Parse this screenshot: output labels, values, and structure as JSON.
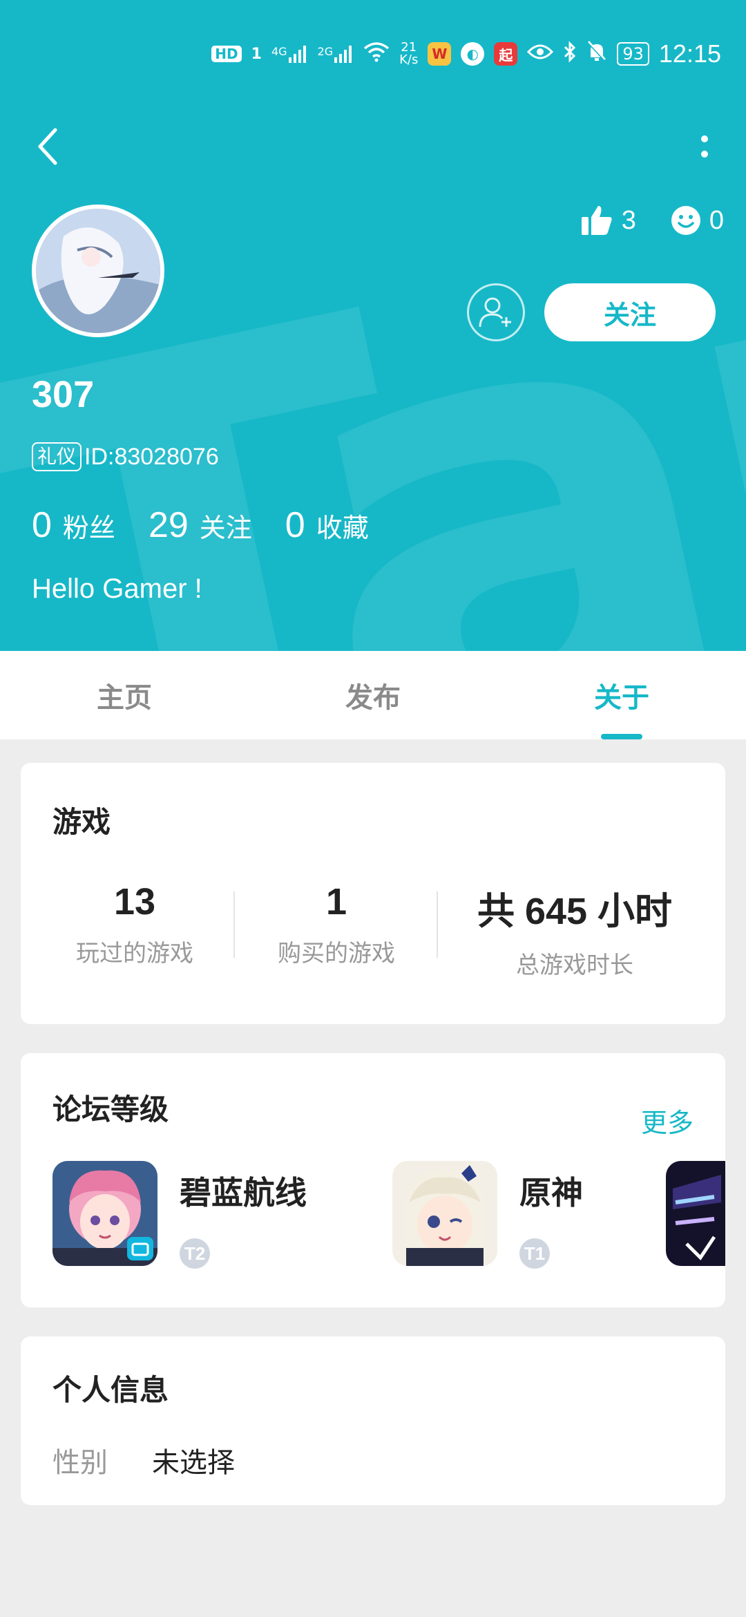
{
  "statusbar": {
    "hd": "HD",
    "sim": "1",
    "net1": "4G",
    "net2": "2G",
    "speed_value": "21",
    "speed_unit": "K/s",
    "battery": "93",
    "time": "12:15"
  },
  "header": {
    "bg_color": "#16b8c8",
    "watermark": "ApTap"
  },
  "profile": {
    "likes": "3",
    "smiles": "0",
    "follow_label": "关注",
    "username": "307",
    "badge": "礼仪",
    "id_text": "ID:83028076",
    "stats": [
      {
        "num": "0",
        "label": "粉丝"
      },
      {
        "num": "29",
        "label": "关注"
      },
      {
        "num": "0",
        "label": "收藏"
      }
    ],
    "bio": "Hello Gamer !"
  },
  "tabs": [
    {
      "label": "主页"
    },
    {
      "label": "发布"
    },
    {
      "label": "关于"
    }
  ],
  "games_card": {
    "title": "游戏",
    "stats": [
      {
        "num": "13",
        "label": "玩过的游戏"
      },
      {
        "num": "1",
        "label": "购买的游戏"
      },
      {
        "num": "共 645 小时",
        "label": "总游戏时长"
      }
    ]
  },
  "forum_card": {
    "title": "论坛等级",
    "more": "更多",
    "items": [
      {
        "name": "碧蓝航线",
        "level": "T2"
      },
      {
        "name": "原神",
        "level": "T1"
      }
    ]
  },
  "info_card": {
    "title": "个人信息",
    "gender_label": "性别",
    "gender_value": "未选择"
  },
  "colors": {
    "accent": "#16b8c8",
    "page_bg": "#ededed"
  }
}
